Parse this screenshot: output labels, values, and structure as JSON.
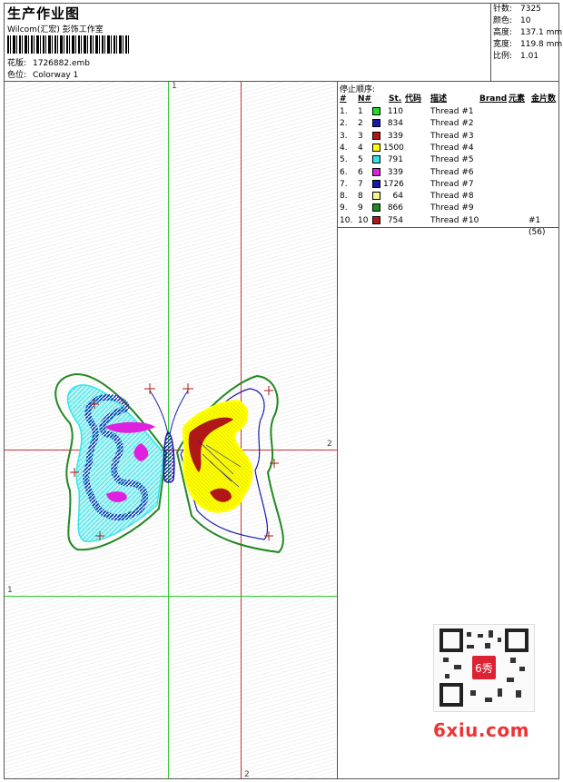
{
  "header": {
    "title": "生产作业图",
    "studio": "Wilcom(汇宏) 彭饰工作室",
    "design_label": "花版:",
    "design_file": "1726882.emb",
    "colorway_label": "色位:",
    "colorway": "Colorway 1"
  },
  "stats": [
    {
      "label": "针数:",
      "value": "7325"
    },
    {
      "label": "颜色:",
      "value": "10"
    },
    {
      "label": "高度:",
      "value": "137.1 mm"
    },
    {
      "label": "宽度:",
      "value": "119.8 mm"
    },
    {
      "label": "比例:",
      "value": "1.01"
    }
  ],
  "axes": {
    "v1": "1",
    "v2": "2",
    "h1": "1",
    "h2": "2"
  },
  "stop_sequence": {
    "title": "停止顺序:",
    "columns": {
      "index": "#",
      "n": "N#",
      "st": "St.",
      "code": "代码",
      "desc": "描述",
      "brand": "Brand",
      "element": "元素",
      "sequin": "金片数"
    },
    "rows": [
      {
        "index": "1.",
        "n": "1",
        "color": "#22dd22",
        "st": "110",
        "desc": "Thread #1",
        "sequin": ""
      },
      {
        "index": "2.",
        "n": "2",
        "color": "#1a1aa8",
        "st": "834",
        "desc": "Thread #2",
        "sequin": ""
      },
      {
        "index": "3.",
        "n": "3",
        "color": "#b01818",
        "st": "339",
        "desc": "Thread #3",
        "sequin": ""
      },
      {
        "index": "4.",
        "n": "4",
        "color": "#ffff00",
        "st": "1500",
        "desc": "Thread #4",
        "sequin": ""
      },
      {
        "index": "5.",
        "n": "5",
        "color": "#33e6e6",
        "st": "791",
        "desc": "Thread #5",
        "sequin": ""
      },
      {
        "index": "6.",
        "n": "6",
        "color": "#e020e0",
        "st": "339",
        "desc": "Thread #6",
        "sequin": ""
      },
      {
        "index": "7.",
        "n": "7",
        "color": "#1a1aa8",
        "st": "1726",
        "desc": "Thread #7",
        "sequin": ""
      },
      {
        "index": "8.",
        "n": "8",
        "color": "#f4f48a",
        "st": "64",
        "desc": "Thread #8",
        "sequin": ""
      },
      {
        "index": "9.",
        "n": "9",
        "color": "#228822",
        "st": "866",
        "desc": "Thread #9",
        "sequin": ""
      },
      {
        "index": "10.",
        "n": "10",
        "color": "#b01818",
        "st": "754",
        "desc": "Thread #10",
        "sequin": "#1 (56)"
      }
    ]
  },
  "watermark": "6xiu.com",
  "qr_stamp": "6秀"
}
